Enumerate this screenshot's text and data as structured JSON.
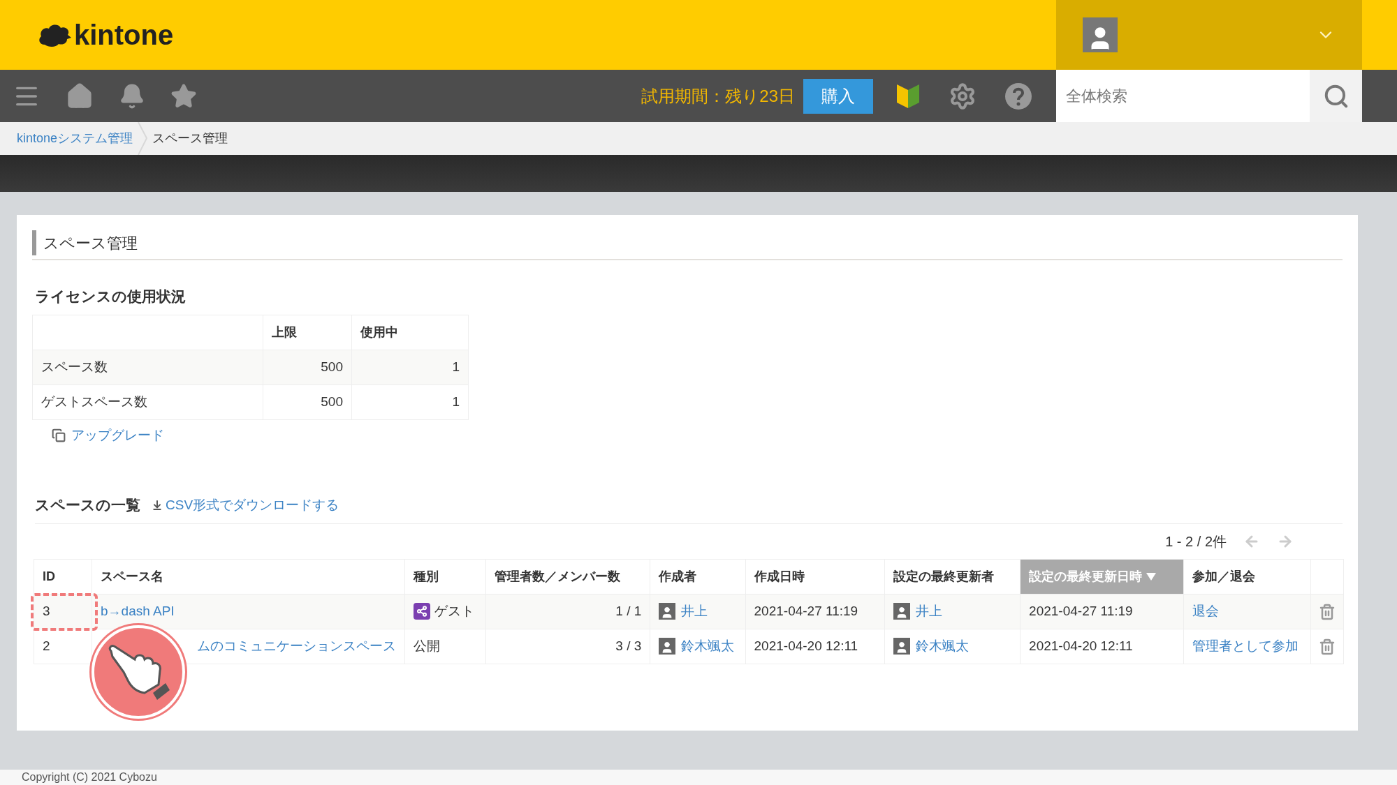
{
  "header": {
    "logo": "kintone"
  },
  "toolbar": {
    "trial": "試用期間：残り23日",
    "buy_button": "購入",
    "search": {
      "placeholder": "全体検索"
    }
  },
  "breadcrumb": [
    {
      "label": "kintoneシステム管理",
      "link": true
    },
    {
      "label": "スペース管理",
      "link": false
    }
  ],
  "page_title": "スペース管理",
  "license": {
    "title": "ライセンスの使用状況",
    "columns": [
      "上限",
      "使用中"
    ],
    "rows": [
      {
        "label": "スペース数",
        "limit": "500",
        "used": "1"
      },
      {
        "label": "ゲストスペース数",
        "limit": "500",
        "used": "1"
      }
    ],
    "upgrade_link": "アップグレード"
  },
  "spaces": {
    "title": "スペースの一覧",
    "csv_link": "CSV形式でダウンロードする",
    "pagination": "1 - 2 / 2件",
    "columns": [
      {
        "label": "ID",
        "sorted": false
      },
      {
        "label": "スペース名",
        "sorted": false
      },
      {
        "label": "種別",
        "sorted": false
      },
      {
        "label": "管理者数／メンバー数",
        "sorted": false
      },
      {
        "label": "作成者",
        "sorted": false
      },
      {
        "label": "作成日時",
        "sorted": false
      },
      {
        "label": "設定の最終更新者",
        "sorted": false
      },
      {
        "label": "設定の最終更新日時",
        "sorted": true
      },
      {
        "label": "参加／退会",
        "sorted": false
      }
    ],
    "rows": [
      {
        "id": "3",
        "name": "b→dash API",
        "type": {
          "kind": "guest",
          "label": "ゲスト"
        },
        "counts": "1 / 1",
        "creator": "井上",
        "created": "2021-04-27 11:19",
        "updater": "井上",
        "updated": "2021-04-27 11:19",
        "action": "退会",
        "annotated": true
      },
      {
        "id": "2",
        "name": "ムのコミュニケーションスペース",
        "type": {
          "kind": "public",
          "label": "公開"
        },
        "counts": "3 / 3",
        "creator": "鈴木颯太",
        "created": "2021-04-20 12:11",
        "updater": "鈴木颯太",
        "updated": "2021-04-20 12:11",
        "action": "管理者として参加",
        "annotated": false
      }
    ]
  },
  "footer": "Copyright (C) 2021 Cybozu"
}
